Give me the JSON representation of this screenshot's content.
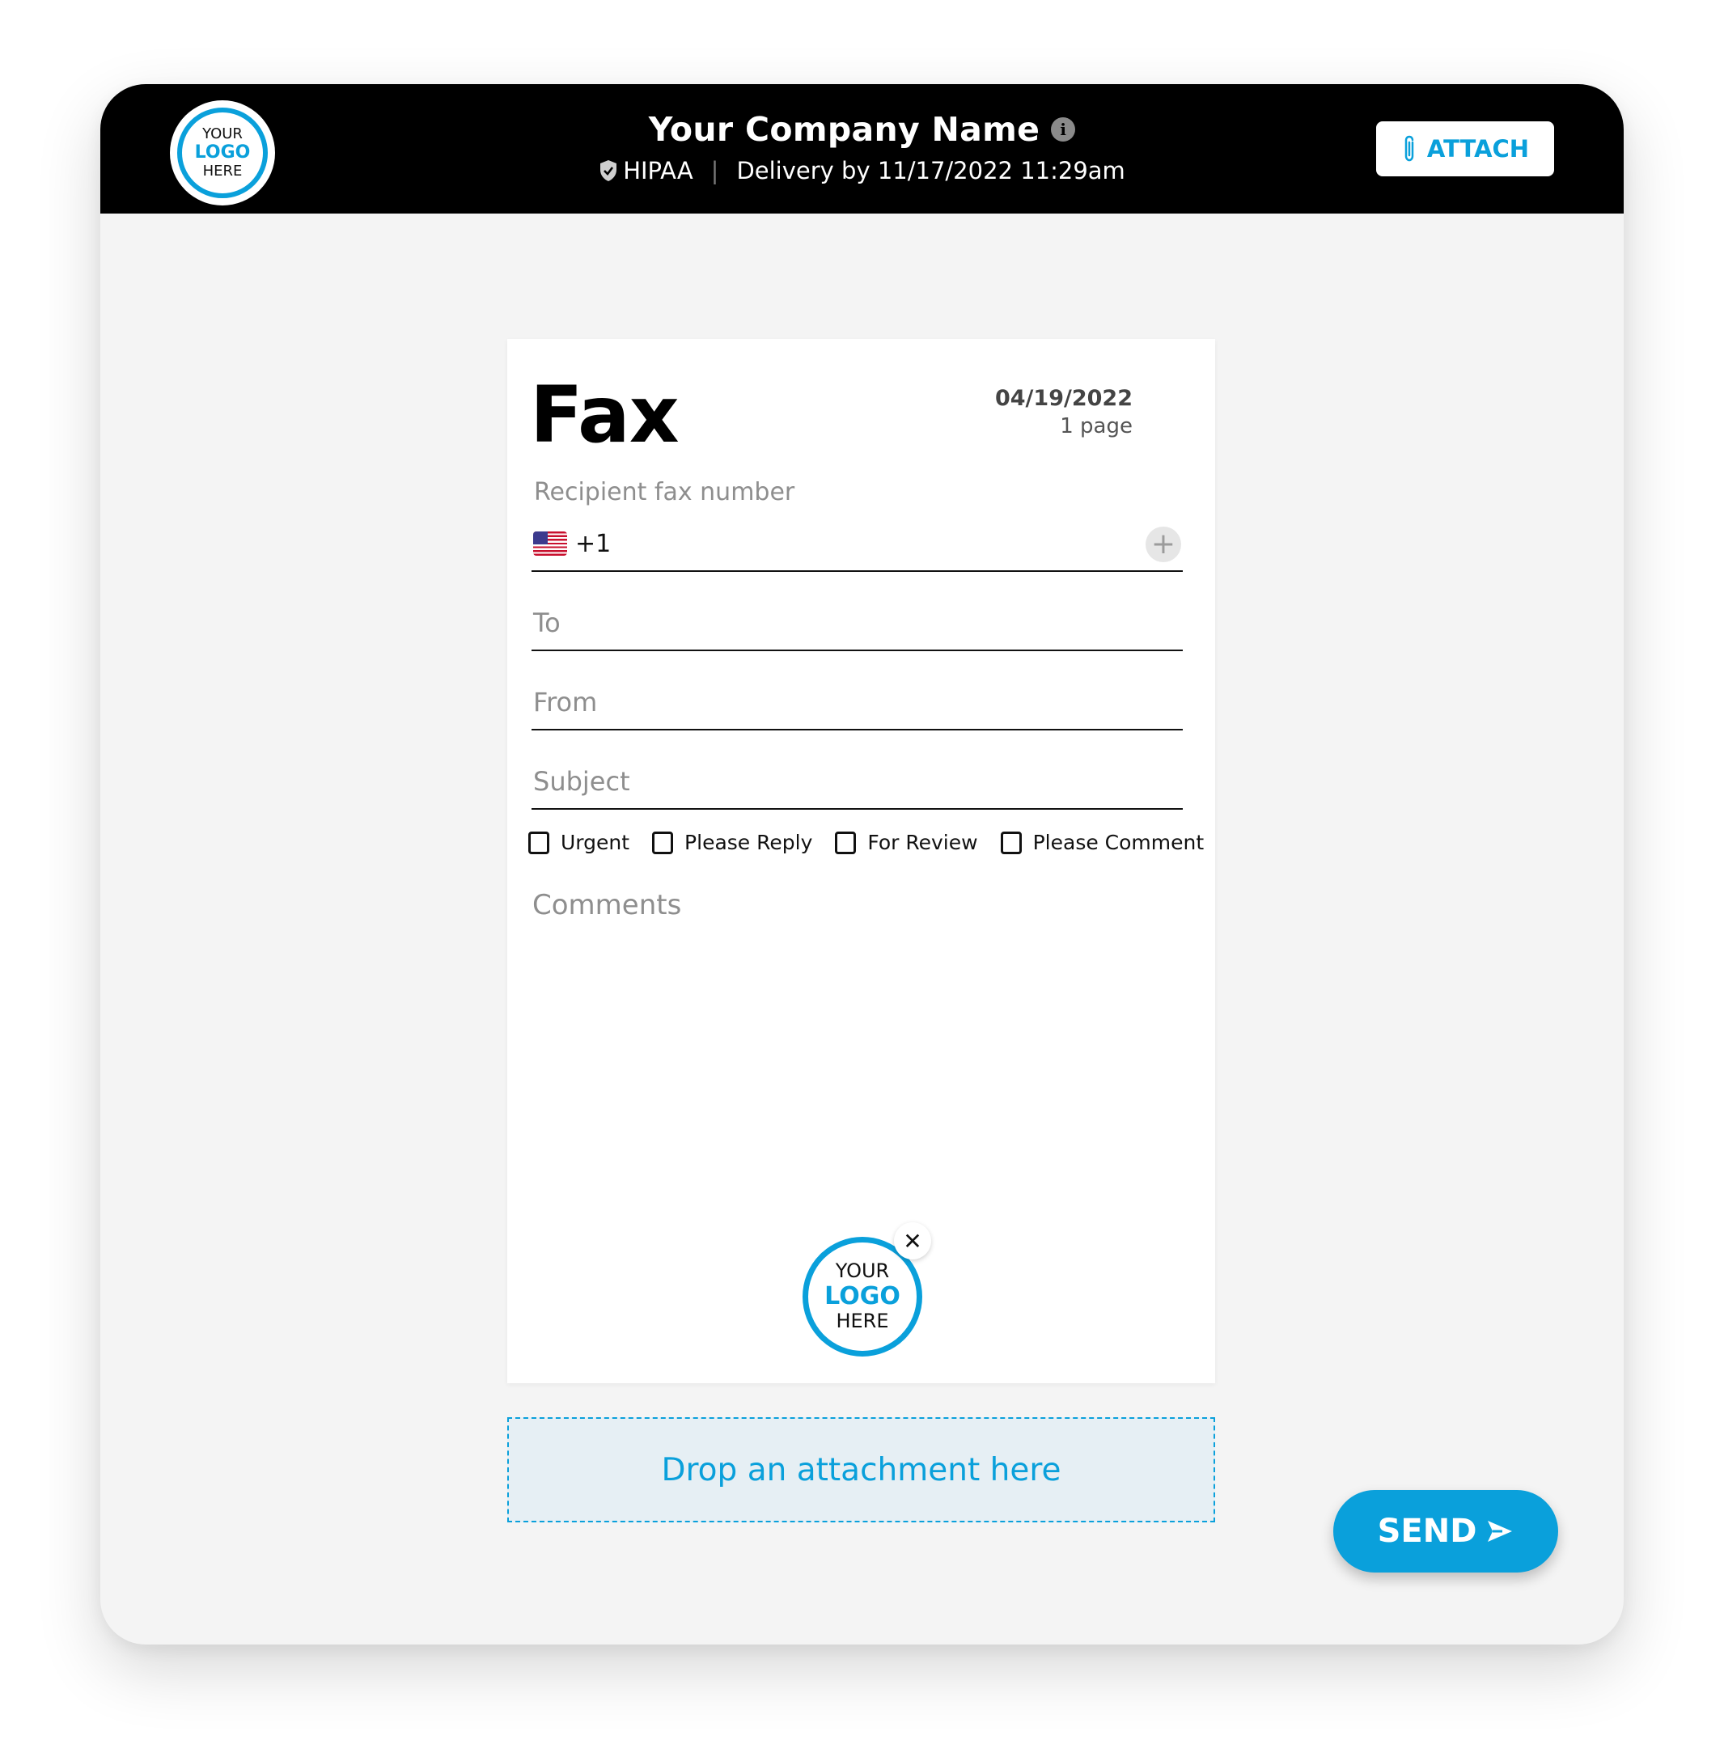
{
  "header": {
    "logo": {
      "line1": "YOUR",
      "line2": "LOGO",
      "line3": "HERE"
    },
    "company_name": "Your Company Name",
    "info_icon": "info-icon",
    "compliance_label": "HIPAA",
    "compliance_icon": "shield-check-icon",
    "separator": "|",
    "delivery_text": "Delivery by 11/17/2022 11:29am",
    "attach_button": {
      "label": "ATTACH",
      "icon": "paperclip-icon"
    }
  },
  "fax": {
    "title": "Fax",
    "date": "04/19/2022",
    "pages": "1 page",
    "recipient_label": "Recipient fax number",
    "country_flag": "us-flag-icon",
    "country_code": "+1",
    "add_recipient_icon": "plus-icon",
    "fields": {
      "to_placeholder": "To",
      "from_placeholder": "From",
      "subject_placeholder": "Subject"
    },
    "checkboxes": [
      {
        "label": "Urgent",
        "checked": false
      },
      {
        "label": "Please Reply",
        "checked": false
      },
      {
        "label": "For Review",
        "checked": false
      },
      {
        "label": "Please Comment",
        "checked": false
      }
    ],
    "comments_placeholder": "Comments",
    "footer_logo": {
      "line1": "YOUR",
      "line2": "LOGO",
      "line3": "HERE"
    },
    "remove_logo_icon": "close-icon"
  },
  "dropzone": {
    "label": "Drop an attachment here"
  },
  "send_button": {
    "label": "SEND",
    "icon": "send-arrow-icon"
  },
  "colors": {
    "accent": "#0aa0db",
    "header_bg": "#000000",
    "page_bg": "#f4f4f4",
    "dropzone_bg": "#e6eff4"
  }
}
